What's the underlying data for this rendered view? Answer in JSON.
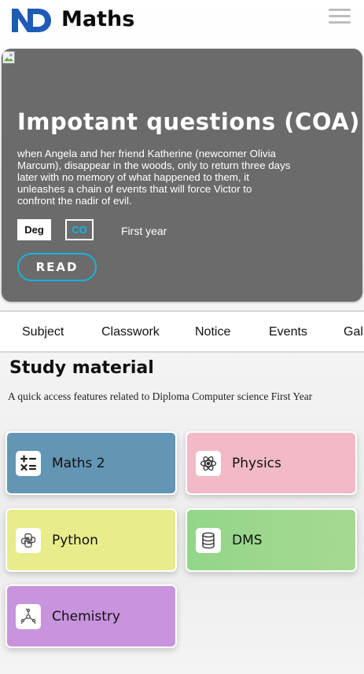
{
  "header": {
    "app_title": "Maths",
    "logo_name": "ND-logo",
    "brand_color": "#1e5bb5"
  },
  "hero": {
    "title": "Impotant questions (COA)",
    "description": "when Angela and her friend Katherine (newcomer Olivia Marcum), disappear in the woods, only to return three days later with no memory of what happened to them, it unleashes a chain of events that will force Victor to confront the nadir of evil.",
    "tag_deg": "Deg",
    "tag_co": "CO",
    "year": "First year",
    "read_label": "READ",
    "background_color": "#6b6b6b",
    "accent_color": "#17b3df"
  },
  "tabs": [
    "Subject",
    "Classwork",
    "Notice",
    "Events",
    "Gall"
  ],
  "study": {
    "title": "Study material",
    "subtitle": "A quick access features related to Diploma Computer science First Year",
    "cards": [
      {
        "label": "Maths 2",
        "icon": "calculator-icon",
        "color": "#6395b4"
      },
      {
        "label": "Physics",
        "icon": "atom-icon",
        "color": "#f1bac6"
      },
      {
        "label": "Python",
        "icon": "python-icon",
        "color": "#e8ec8a"
      },
      {
        "label": "DMS",
        "icon": "database-icon",
        "color": "#9fd88f"
      },
      {
        "label": "Chemistry",
        "icon": "molecule-icon",
        "color": "#c894dd"
      }
    ]
  }
}
